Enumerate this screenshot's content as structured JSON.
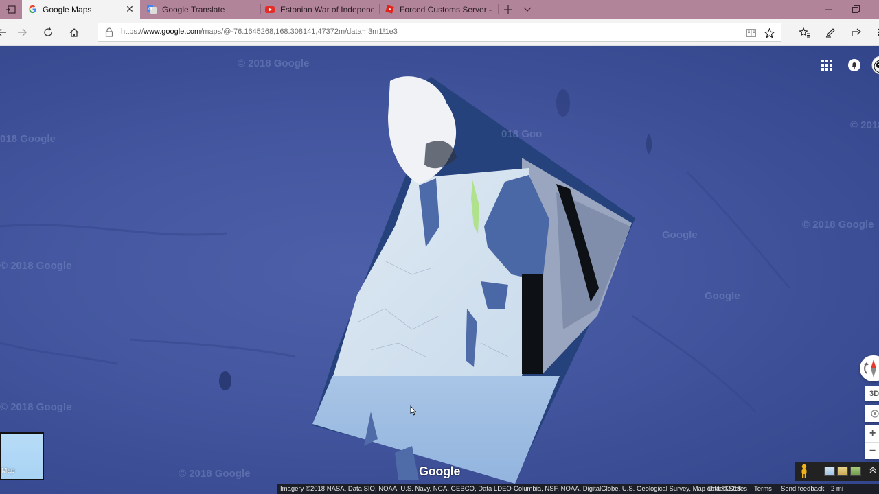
{
  "tabs": [
    {
      "title": "Google Maps",
      "favicon": "google-g-icon",
      "active": true
    },
    {
      "title": "Google Translate",
      "favicon": "translate-icon",
      "active": false
    },
    {
      "title": "Estonian War of Independen",
      "favicon": "youtube-icon",
      "active": false
    },
    {
      "title": "Forced Customs Server - Rc",
      "favicon": "roblox-icon",
      "active": false
    }
  ],
  "address_bar": {
    "url_prefix": "https://",
    "url_host": "www.google.com",
    "url_path": "/maps/@-76.1645268,168.308141,47372m/data=!3m1!1e3"
  },
  "map": {
    "watermark": "© 2018 Google",
    "watermark_left": "018 Google",
    "watermark_right": "© 2018 Google",
    "watermark_faint": "Google",
    "watermark_mid": "018 Goo",
    "logo": "Google",
    "minimap_label": "Map",
    "btn_3d": "3D",
    "zoom_in": "+",
    "zoom_out": "−"
  },
  "attribution": {
    "imagery": "Imagery ©2018 NASA, Data SIO, NOAA, U.S. Navy, NGA, GEBCO, Data LDEO-Columbia, NSF, NOAA, DigitalGlobe, U.S. Geological Survey, Map data ©2018",
    "country": "United States",
    "terms": "Terms",
    "feedback": "Send feedback",
    "scale": "2 mi"
  },
  "colors": {
    "ocean": "#4457a0",
    "tab_strip": "#b2849a",
    "active_tab": "#f3f3f3"
  }
}
